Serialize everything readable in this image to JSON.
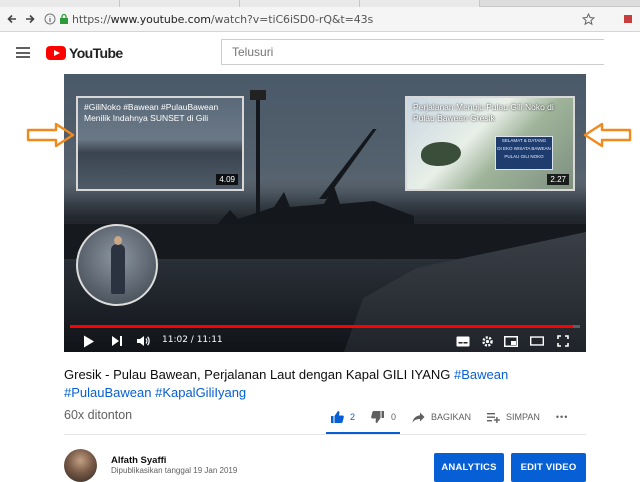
{
  "browser": {
    "url_protocol": "https://",
    "url_host": "www.youtube.com",
    "url_path": "/watch?v=tiC6iSD0-rQ&t=43s"
  },
  "header": {
    "logo_text": "YouTube",
    "search_placeholder": "Telusuri"
  },
  "player": {
    "time_current": "11:02",
    "time_separator": " / ",
    "time_total": "11:11",
    "progress_fraction": 0.987,
    "end_cards": [
      {
        "title": "#GiliNoko #Bawean #PulauBawean Menilik Indahnya SUNSET di Gili",
        "duration": "4.09"
      },
      {
        "title": "Perjalanan Menuju Pulau Gili Noko di Pulau Bawean Gresik",
        "duration": "2.27"
      }
    ],
    "end_card_sign_lines": [
      "SELAMAT & DATANG",
      "DI EKO WISATA BAWEAN",
      "PULAU GILI NOKO"
    ]
  },
  "annotation": {
    "arrow_color": "#f08a1d"
  },
  "video": {
    "title_plain": "Gresik - Pulau Bawean, Perjalanan Laut dengan Kapal GILI IYANG ",
    "hashtag1": "#Bawean",
    "hashtag2": "#PulauBawean",
    "hashtag3": "#KapalGiliIyang",
    "views": "60x ditonton"
  },
  "actions": {
    "like_count": "2",
    "dislike_count": "0",
    "share_label": "BAGIKAN",
    "save_label": "SIMPAN",
    "more_label": "•••"
  },
  "channel": {
    "name": "Alfath Syaffi",
    "published": "Dipublikasikan tanggal 19 Jan 2019"
  },
  "buttons": {
    "analytics": "ANALYTICS",
    "edit_video": "EDIT VIDEO"
  },
  "colors": {
    "accent_blue": "#065fd4",
    "brand_red": "#ff0000"
  }
}
